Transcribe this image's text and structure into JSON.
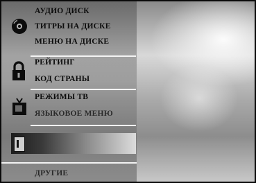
{
  "menu": {
    "disc_group": {
      "icon": "disc-icon",
      "items": [
        "АУДИО ДИСК",
        "ТИТРЫ НА ДИСКЕ",
        "МЕНЮ НА ДИСКЕ"
      ]
    },
    "lock_group": {
      "icon": "lock-icon",
      "items": [
        "РЕЙТИНГ",
        "КОД СТРАНЫ"
      ]
    },
    "tv_group": {
      "icon": "tv-icon",
      "items": [
        "РЕЖИМЫ ТВ",
        "ЯЗЫКОВОЕ МЕНЮ"
      ]
    },
    "selected_group": {
      "icon": "speaker-icon"
    },
    "other_group": {
      "items": [
        "ДРУГИЕ"
      ]
    }
  },
  "colors": {
    "menu_text": "#0c0c0c",
    "divider": "#f4f4f4",
    "panel_bg": "#7a7a7a"
  }
}
